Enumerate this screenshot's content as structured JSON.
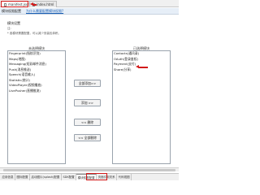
{
  "tabs": [
    {
      "label": "manifest.json",
      "active": true
    },
    {
      "label": "index.html",
      "active": false
    }
  ],
  "toolbar": {
    "title": "模块权限配置",
    "link": "为什么需要配置模块权限?"
  },
  "section": {
    "title": "模块设置",
    "note_label": "注:",
    "note_text": "* 各模块需要配置，可以减少安装包体积。"
  },
  "lists": {
    "left_label": "未选择模块",
    "right_label": "已选择模块",
    "unselected": [
      "Fingerprint(指纹识别)",
      "Maps(地图)",
      "Messaging(短彩邮件消息)",
      "Push(消息推送)",
      "Speech(语音输入)",
      "Statistic(统计)",
      "VideoPlayer(视频播放)",
      "LivePusher(直播推流)"
    ],
    "selected": [
      "Contacts(通讯录)",
      "OAuth(登录鉴权)",
      "Payment(支付)",
      "Share(分享)"
    ]
  },
  "buttons": {
    "add_all": "全部添加>>",
    "add": "添加 >>",
    "remove": "<< 删除",
    "remove_all": "<< 全部删除"
  },
  "bottom_tabs": [
    {
      "label": "应用信息",
      "active": false
    },
    {
      "label": "图标配置",
      "active": false
    },
    {
      "label": "启动图片(splash)配置",
      "active": false
    },
    {
      "label": "SDK配置",
      "active": false
    },
    {
      "label": "模块权限配置",
      "active": true
    },
    {
      "label": "页面引用关系",
      "active": false
    },
    {
      "label": "代码视图",
      "active": false
    }
  ],
  "colors": {
    "highlight": "#d21a1a",
    "toolbar_bg": "#e6eef7",
    "link": "#1a5fb4"
  }
}
